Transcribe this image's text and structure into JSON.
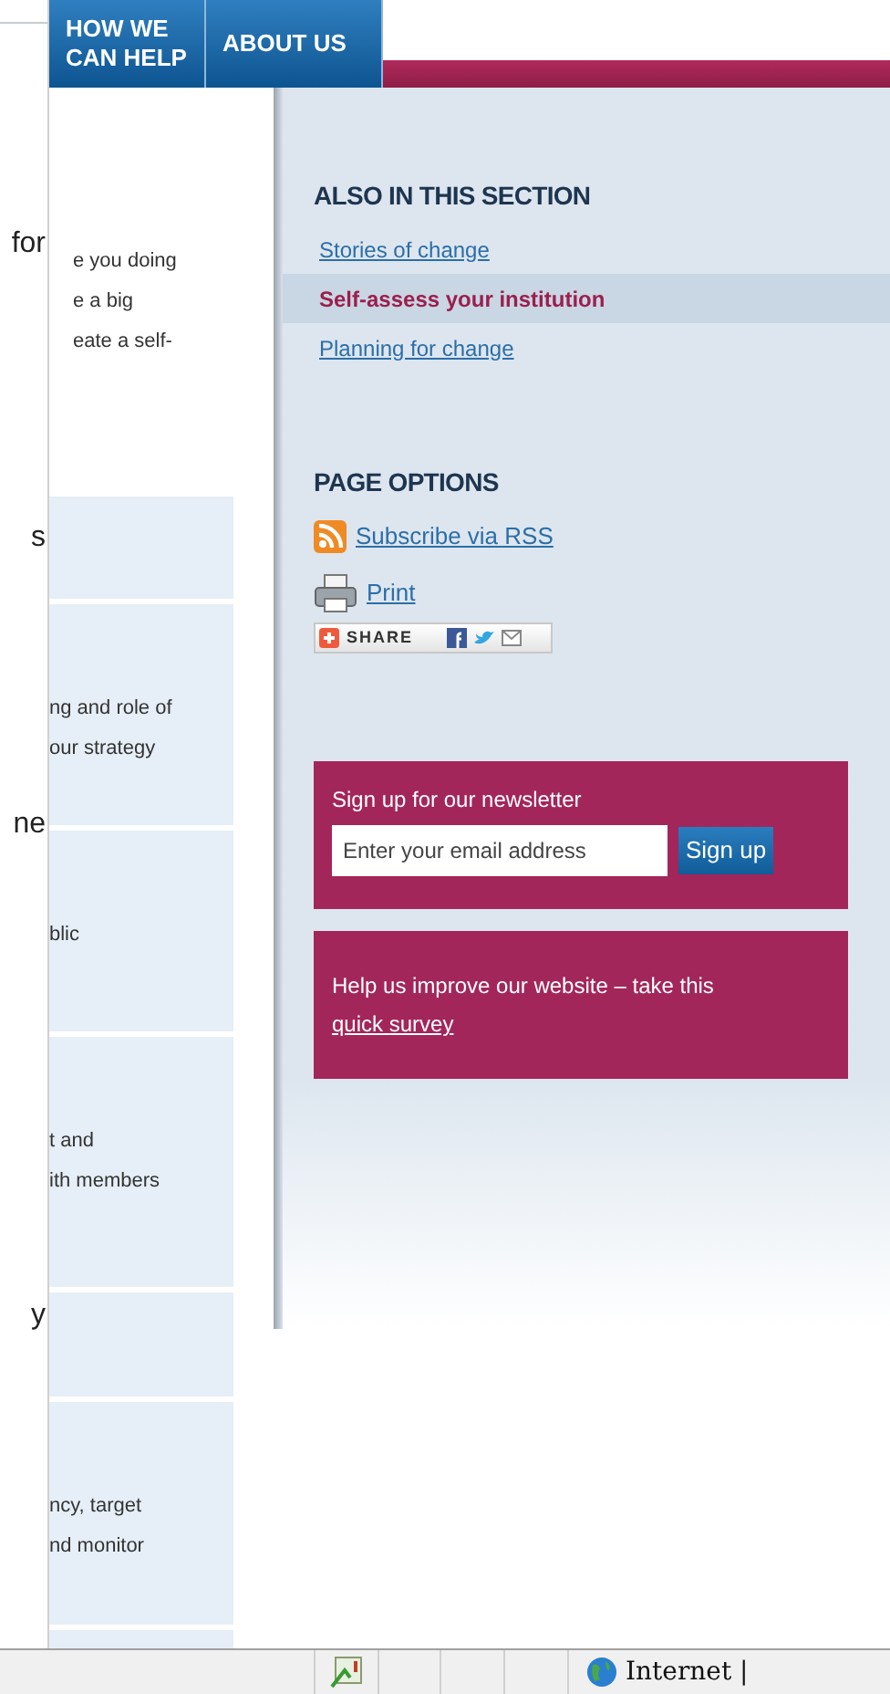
{
  "nav": {
    "tabs": [
      {
        "label": "HOW WE CAN HELP"
      },
      {
        "label": "ABOUT US"
      }
    ]
  },
  "overlapping_window": {
    "texts": [
      "for",
      "s",
      "ne",
      "y"
    ]
  },
  "content": {
    "intro_lines": [
      "e you doing",
      "e a big",
      "eate a self-"
    ],
    "cards": [
      {
        "kind": "empty"
      },
      {
        "kind": "text",
        "lines": [
          "ng and role of",
          "our strategy"
        ]
      },
      {
        "kind": "text",
        "lines": [
          "blic"
        ]
      },
      {
        "kind": "text",
        "lines": [
          "t and",
          "ith members"
        ]
      },
      {
        "kind": "empty"
      },
      {
        "kind": "text",
        "lines": [
          "ncy, target",
          "nd monitor"
        ]
      },
      {
        "kind": "empty"
      }
    ]
  },
  "sidebar": {
    "section_title": "ALSO IN THIS SECTION",
    "section_links": [
      {
        "label": "Stories of change",
        "selected": false
      },
      {
        "label": "Self-assess your institution",
        "selected": true
      },
      {
        "label": "Planning for change",
        "selected": false
      }
    ],
    "options_title": "PAGE OPTIONS",
    "options": [
      {
        "kind": "rss",
        "label": "Subscribe via RSS"
      },
      {
        "kind": "print",
        "label": "Print"
      },
      {
        "kind": "share",
        "label": "SHARE"
      }
    ],
    "newsletter": {
      "title": "Sign up for our newsletter",
      "placeholder": "Enter your email address",
      "button": "Sign up"
    },
    "survey": {
      "text": "Help us improve our website – take this",
      "link": "quick survey"
    }
  },
  "status_bar": {
    "zone": "Internet |"
  }
}
